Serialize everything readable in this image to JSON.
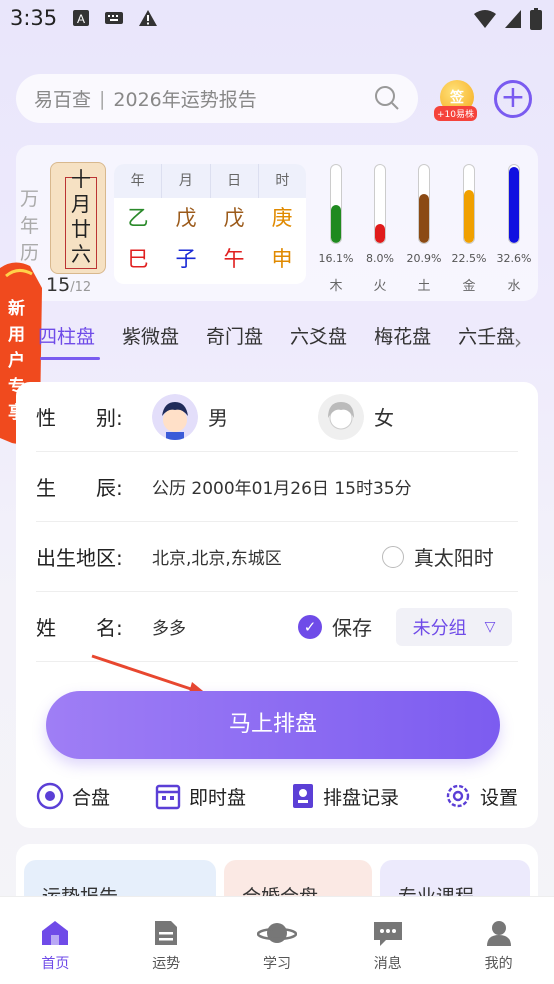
{
  "status": {
    "time": "3:35"
  },
  "search": {
    "brand": "易百查",
    "placeholder": "2026年运势报告"
  },
  "sign": {
    "coin": "签",
    "reward": "+10易株"
  },
  "calendar": {
    "wnl": [
      "万",
      "年",
      "历"
    ],
    "lunar_tag": "十月廿六",
    "day": "15",
    "month": "/12",
    "ganzhi_headers": [
      "年",
      "月",
      "日",
      "时"
    ],
    "gan": [
      {
        "char": "乙",
        "color": "#2b8a2b"
      },
      {
        "char": "戊",
        "color": "#9b5a1a"
      },
      {
        "char": "戊",
        "color": "#9b5a1a"
      },
      {
        "char": "庚",
        "color": "#e08a00"
      }
    ],
    "zhi": [
      {
        "char": "巳",
        "color": "#e02020"
      },
      {
        "char": "子",
        "color": "#1a2ad6"
      },
      {
        "char": "午",
        "color": "#e02020"
      },
      {
        "char": "申",
        "color": "#e08a00"
      }
    ],
    "wuxing": [
      {
        "name": "木",
        "pct": "16.1%",
        "value": 16.1,
        "color": "#1f8a1f"
      },
      {
        "name": "火",
        "pct": "8.0%",
        "value": 8.0,
        "color": "#e01b1b"
      },
      {
        "name": "土",
        "pct": "20.9%",
        "value": 20.9,
        "color": "#8b4a14"
      },
      {
        "name": "金",
        "pct": "22.5%",
        "value": 22.5,
        "color": "#f0a000"
      },
      {
        "name": "水",
        "pct": "32.6%",
        "value": 32.6,
        "color": "#1010e0"
      }
    ]
  },
  "promo": {
    "text": [
      "新",
      "用",
      "户",
      "专",
      "享"
    ]
  },
  "tabs": [
    "四柱盘",
    "紫微盘",
    "奇门盘",
    "六爻盘",
    "梅花盘",
    "六壬盘"
  ],
  "form": {
    "gender_label": "性　　别:",
    "male": "男",
    "female": "女",
    "birth_label": "生　　辰:",
    "birth_value": "公历 2000年01月26日 15时35分",
    "place_label": "出生地区:",
    "place_value": "北京,北京,东城区",
    "solar_label": "真太阳时",
    "name_label": "姓　　名:",
    "name_value": "多多",
    "save_label": "保存",
    "group_value": "未分组",
    "submit": "马上排盘"
  },
  "quick": [
    "合盘",
    "即时盘",
    "排盘记录",
    "设置"
  ],
  "cards": [
    "运势报告",
    "合婚合盘",
    "专业课程"
  ],
  "nav": [
    "首页",
    "运势",
    "学习",
    "消息",
    "我的"
  ]
}
